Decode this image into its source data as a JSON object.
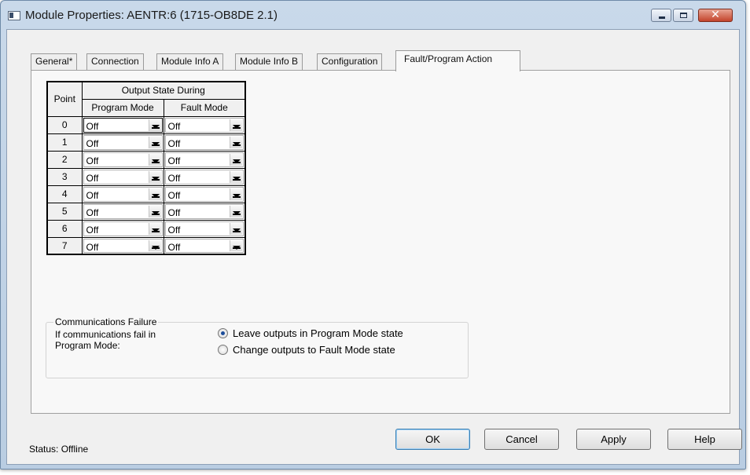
{
  "window": {
    "title": "Module Properties: AENTR:6 (1715-OB8DE 2.1)"
  },
  "tabs": [
    {
      "label": "General*"
    },
    {
      "label": "Connection"
    },
    {
      "label": "Module Info A"
    },
    {
      "label": "Module Info B"
    },
    {
      "label": "Configuration"
    },
    {
      "label": "Fault/Program Action",
      "active": true
    }
  ],
  "table": {
    "point_header": "Point",
    "group_header": "Output State During",
    "program_header": "Program Mode",
    "fault_header": "Fault Mode",
    "rows": [
      {
        "point": "0",
        "program": "Off",
        "fault": "Off"
      },
      {
        "point": "1",
        "program": "Off",
        "fault": "Off"
      },
      {
        "point": "2",
        "program": "Off",
        "fault": "Off"
      },
      {
        "point": "3",
        "program": "Off",
        "fault": "Off"
      },
      {
        "point": "4",
        "program": "Off",
        "fault": "Off"
      },
      {
        "point": "5",
        "program": "Off",
        "fault": "Off"
      },
      {
        "point": "6",
        "program": "Off",
        "fault": "Off"
      },
      {
        "point": "7",
        "program": "Off",
        "fault": "Off"
      }
    ]
  },
  "comm_failure": {
    "legend": "Communications Failure",
    "line1": "If communications fail in",
    "line2": "Program Mode:",
    "option_leave": "Leave outputs in Program Mode state",
    "option_change": "Change outputs to Fault Mode state",
    "selected": "leave"
  },
  "status": {
    "label": "Status:",
    "value": "Offline"
  },
  "buttons": {
    "ok": "OK",
    "cancel": "Cancel",
    "apply": "Apply",
    "help": "Help"
  },
  "colors": {
    "radio_selected": "#1c4d9a",
    "close_button": "#c3432b"
  }
}
